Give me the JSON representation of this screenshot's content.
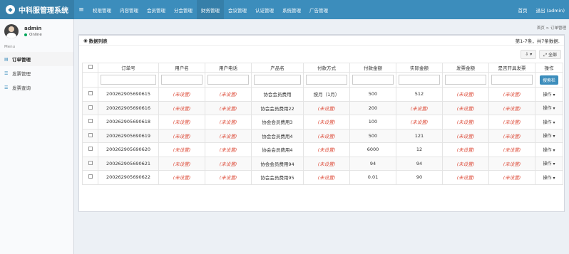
{
  "app": {
    "brand": "中科服管理系统",
    "toggle": "≡"
  },
  "nav": [
    "权限管理",
    "内容管理",
    "会员管理",
    "分会管理",
    "财务管理",
    "会议管理",
    "认证管理",
    "系统管理",
    "广告管理"
  ],
  "nav_active": 4,
  "top_right": {
    "home": "首页",
    "logout": "退出 (admin)"
  },
  "user": {
    "name": "admin",
    "status": "Online"
  },
  "sidebar": {
    "heading": "Menu",
    "items": [
      {
        "label": "订单管理",
        "icon": "▤"
      },
      {
        "label": "发票管理",
        "icon": "☰"
      },
      {
        "label": "发票查询",
        "icon": "☰"
      }
    ]
  },
  "breadcrumb": "首页 > 订单管理",
  "box": {
    "title": "数据列表",
    "count": "第1-7条，共7条数据."
  },
  "tools": {
    "export": "⇩ ▾",
    "all": "⤢ 全部"
  },
  "table": {
    "columns": [
      "订单号",
      "用户名",
      "用户电话",
      "产品名",
      "付款方式",
      "付款金额",
      "实际金额",
      "发票金额",
      "是否开具发票",
      "操作"
    ],
    "search_label": "搜索栏",
    "op_label": "操作 ▾",
    "rows": [
      [
        "200262905690615",
        "(未设置)",
        "(未设置)",
        "协会会员费用",
        "按月（1月）",
        "500",
        "512",
        "(未设置)",
        "(未设置)"
      ],
      [
        "200262905690616",
        "(未设置)",
        "(未设置)",
        "协会会员费用22",
        "(未设置)",
        "200",
        "(未设置)",
        "(未设置)",
        "(未设置)"
      ],
      [
        "200262905690618",
        "(未设置)",
        "(未设置)",
        "协会会员费用3",
        "(未设置)",
        "100",
        "(未设置)",
        "(未设置)",
        "(未设置)"
      ],
      [
        "200262905690619",
        "(未设置)",
        "(未设置)",
        "协会会员费用4",
        "(未设置)",
        "500",
        "121",
        "(未设置)",
        "(未设置)"
      ],
      [
        "200262905690620",
        "(未设置)",
        "(未设置)",
        "协会会员费用4",
        "(未设置)",
        "6000",
        "12",
        "(未设置)",
        "(未设置)"
      ],
      [
        "200262905690621",
        "(未设置)",
        "(未设置)",
        "协会会员费用94",
        "(未设置)",
        "94",
        "94",
        "(未设置)",
        "(未设置)"
      ],
      [
        "200262905690622",
        "(未设置)",
        "(未设置)",
        "协会会员费用95",
        "(未设置)",
        "0.01",
        "90",
        "(未设置)",
        "(未设置)"
      ]
    ]
  }
}
